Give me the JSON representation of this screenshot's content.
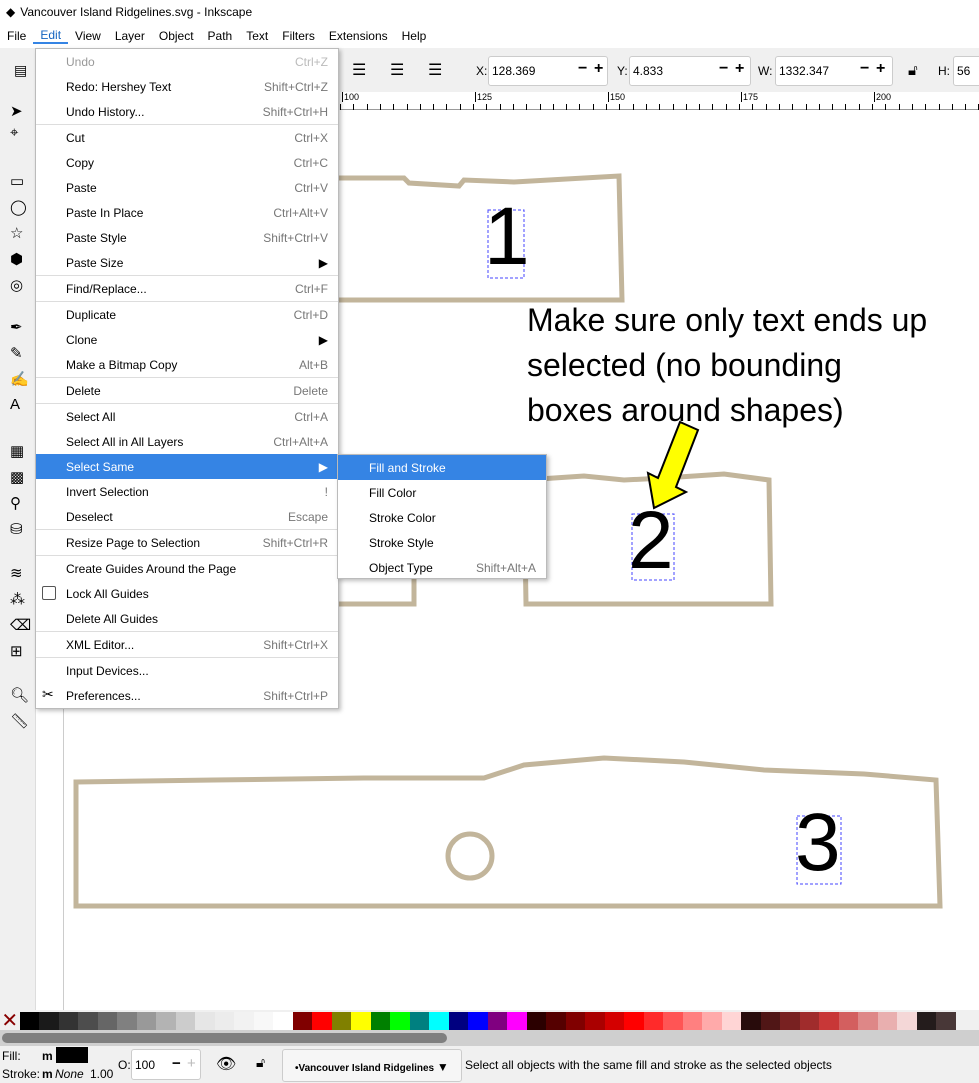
{
  "window": {
    "title": "Vancouver Island Ridgelines.svg - Inkscape"
  },
  "menubar": [
    "File",
    "Edit",
    "View",
    "Layer",
    "Object",
    "Path",
    "Text",
    "Filters",
    "Extensions",
    "Help"
  ],
  "active_menu": "Edit",
  "toolbar": {
    "x_label": "X:",
    "x": "128.369",
    "y_label": "Y:",
    "y": "4.833",
    "w_label": "W:",
    "w": "1332.347",
    "h_label": "H:",
    "h": "56"
  },
  "ruler": [
    "100",
    "125",
    "150",
    "175",
    "200"
  ],
  "edit_menu": [
    {
      "label": "Undo",
      "shortcut": "Ctrl+Z",
      "disabled": true
    },
    {
      "label": "Redo: Hershey Text",
      "shortcut": "Shift+Ctrl+Z"
    },
    {
      "label": "Undo History...",
      "shortcut": "Shift+Ctrl+H",
      "sep": true
    },
    {
      "label": "Cut",
      "shortcut": "Ctrl+X"
    },
    {
      "label": "Copy",
      "shortcut": "Ctrl+C"
    },
    {
      "label": "Paste",
      "shortcut": "Ctrl+V"
    },
    {
      "label": "Paste In Place",
      "shortcut": "Ctrl+Alt+V"
    },
    {
      "label": "Paste Style",
      "shortcut": "Shift+Ctrl+V"
    },
    {
      "label": "Paste Size",
      "shortcut": "▶",
      "sep": true
    },
    {
      "label": "Find/Replace...",
      "shortcut": "Ctrl+F",
      "sep": true
    },
    {
      "label": "Duplicate",
      "shortcut": "Ctrl+D"
    },
    {
      "label": "Clone",
      "shortcut": "▶"
    },
    {
      "label": "Make a Bitmap Copy",
      "shortcut": "Alt+B",
      "sep": true
    },
    {
      "label": "Delete",
      "shortcut": "Delete",
      "sep": true
    },
    {
      "label": "Select All",
      "shortcut": "Ctrl+A"
    },
    {
      "label": "Select All in All Layers",
      "shortcut": "Ctrl+Alt+A"
    },
    {
      "label": "Select Same",
      "shortcut": "▶",
      "highlighted": true
    },
    {
      "label": "Invert Selection",
      "shortcut": "!"
    },
    {
      "label": "Deselect",
      "shortcut": "Escape",
      "sep": true
    },
    {
      "label": "Resize Page to Selection",
      "shortcut": "Shift+Ctrl+R",
      "sep": true
    },
    {
      "label": "Create Guides Around the Page",
      "shortcut": ""
    },
    {
      "label": "Lock All Guides",
      "shortcut": "",
      "checkbox": true
    },
    {
      "label": "Delete All Guides",
      "shortcut": "",
      "sep": true
    },
    {
      "label": "XML Editor...",
      "shortcut": "Shift+Ctrl+X",
      "sep": true
    },
    {
      "label": "Input Devices...",
      "shortcut": ""
    },
    {
      "label": "Preferences...",
      "shortcut": "Shift+Ctrl+P"
    }
  ],
  "select_same_submenu": [
    {
      "label": "Fill and Stroke",
      "shortcut": "",
      "highlighted": true
    },
    {
      "label": "Fill Color",
      "shortcut": ""
    },
    {
      "label": "Stroke Color",
      "shortcut": ""
    },
    {
      "label": "Stroke Style",
      "shortcut": ""
    },
    {
      "label": "Object Type",
      "shortcut": "Shift+Alt+A"
    }
  ],
  "canvas": {
    "labels": [
      "1",
      "2",
      "3"
    ],
    "annotation": [
      "Make sure only text ends up",
      "selected (no bounding",
      "boxes around shapes)"
    ],
    "shape_color": "#c2b59b",
    "arrow_color": "#ffff00"
  },
  "palette": [
    "#000000",
    "#1a1a1a",
    "#333333",
    "#4d4d4d",
    "#666666",
    "#808080",
    "#999999",
    "#b3b3b3",
    "#cccccc",
    "#e6e6e6",
    "#ececec",
    "#f2f2f2",
    "#f8f8f8",
    "#ffffff",
    "#800000",
    "#ff0000",
    "#808000",
    "#ffff00",
    "#008000",
    "#00ff00",
    "#008080",
    "#00ffff",
    "#000080",
    "#0000ff",
    "#800080",
    "#ff00ff",
    "#2b0000",
    "#550000",
    "#800000",
    "#aa0000",
    "#d40000",
    "#ff0000",
    "#ff2a2a",
    "#ff5555",
    "#ff8080",
    "#ffaaaa",
    "#ffd5d5",
    "#280b0b",
    "#501616",
    "#782121",
    "#a02c2c",
    "#c83737",
    "#d35f5f",
    "#de8787",
    "#e9afaf",
    "#f4d7d7",
    "#241c1c",
    "#483737"
  ],
  "status": {
    "fill_label": "Fill:",
    "fill_m": "m",
    "fill_color": "#000000",
    "stroke_label": "Stroke:",
    "stroke_m": "m",
    "stroke_value": "None",
    "stroke_width": "1.00",
    "opacity_label": "O:",
    "opacity": "100",
    "layer": "•Vancouver Island Ridgelines",
    "message": "Select all objects with the same fill and stroke as the selected objects"
  }
}
